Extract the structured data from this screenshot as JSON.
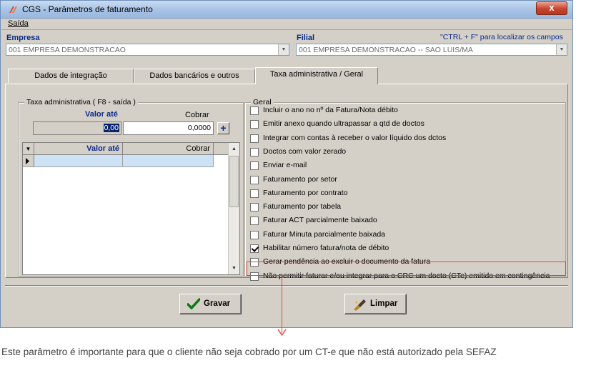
{
  "window": {
    "title": "CGS - Parâmetros de faturamento",
    "close_label": "x"
  },
  "menu": {
    "saida": "Saída"
  },
  "empresa": {
    "label": "Empresa",
    "value": "001 EMPRESA DEMONSTRACAO"
  },
  "filial": {
    "label": "Filial",
    "value": "001 EMPRESA DEMONSTRACAO -- SAO LUIS/MA"
  },
  "hint": "\"CTRL + F\" para localizar os campos",
  "tabs": [
    {
      "label": "Dados de integração",
      "active": false
    },
    {
      "label": "Dados bancários e outros",
      "active": false
    },
    {
      "label": "Taxa administrativa / Geral",
      "active": true
    }
  ],
  "taxa": {
    "group_title": "Taxa administrativa ( F8 - saída )",
    "valor_ate_label": "Valor até",
    "cobrar_label": "Cobrar",
    "valor_ate_value": "0,00",
    "cobrar_value": "0,0000",
    "plus_label": "+",
    "grid_headers": [
      "Valor até",
      "Cobrar"
    ]
  },
  "geral": {
    "group_title": "Geral",
    "options": [
      {
        "label": "Incluir o ano no nº da Fatura/Nota débito",
        "checked": false
      },
      {
        "label": "Emitir anexo quando ultrapassar a qtd de doctos",
        "checked": false
      },
      {
        "label": "Integrar com contas à receber o valor líquido dos dctos",
        "checked": false
      },
      {
        "label": "Doctos com valor zerado",
        "checked": false
      },
      {
        "label": "Enviar e-mail",
        "checked": false
      },
      {
        "label": "Faturamento por setor",
        "checked": false
      },
      {
        "label": "Faturamento por contrato",
        "checked": false
      },
      {
        "label": "Faturamento por tabela",
        "checked": false
      },
      {
        "label": "Faturar ACT parcialmente baixado",
        "checked": false
      },
      {
        "label": "Faturar Minuta parcialmente baixada",
        "checked": false
      },
      {
        "label": "Habilitar número fatura/nota de débito",
        "checked": true
      },
      {
        "label": "Gerar pendência ao excluir o documento da fatura",
        "checked": false
      },
      {
        "label": "Não permitir faturar e/ou integrar para o CRC um docto (CTe) emitido em contingência",
        "checked": false
      }
    ]
  },
  "buttons": {
    "gravar": "Gravar",
    "limpar": "Limpar"
  },
  "note": "Este parâmetro é importante para que o cliente não seja cobrado por um CT-e que não está autorizado pela SEFAZ",
  "colors": {
    "highlight": "#e0443a",
    "label_blue": "#0a2a8a",
    "title_bar": "#a9c4e6"
  }
}
